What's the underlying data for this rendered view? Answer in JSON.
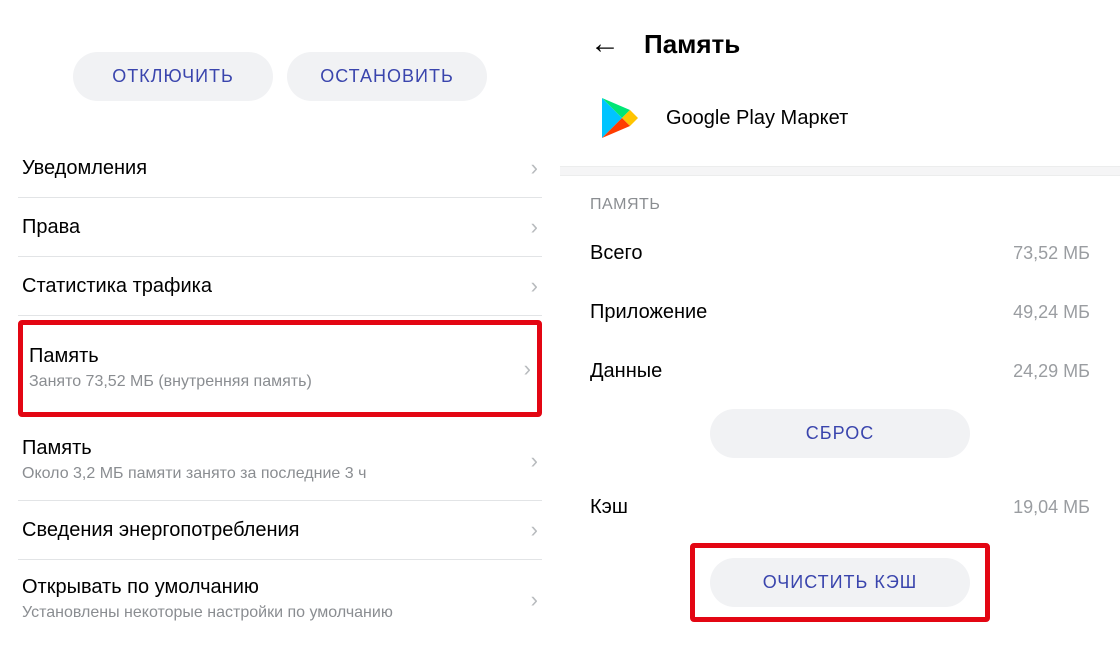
{
  "left": {
    "buttons": {
      "disable": "ОТКЛЮЧИТЬ",
      "stop": "ОСТАНОВИТЬ"
    },
    "items": {
      "notifications": "Уведомления",
      "permissions": "Права",
      "traffic": "Статистика трафика",
      "storage_title": "Память",
      "storage_sub": "Занято 73,52 МБ (внутренняя память)",
      "memory_title": "Память",
      "memory_sub": "Около 3,2 МБ памяти занято за последние 3 ч",
      "energy": "Сведения энергопотребления",
      "default_title": "Открывать по умолчанию",
      "default_sub": "Установлены некоторые настройки по умолчанию"
    }
  },
  "right": {
    "header": "Память",
    "app_name": "Google Play Маркет",
    "section": "ПАМЯТЬ",
    "rows": {
      "total_k": "Всего",
      "total_v": "73,52 МБ",
      "app_k": "Приложение",
      "app_v": "49,24 МБ",
      "data_k": "Данные",
      "data_v": "24,29 МБ",
      "cache_k": "Кэш",
      "cache_v": "19,04 МБ"
    },
    "buttons": {
      "reset": "СБРОС",
      "clear_cache": "ОЧИСТИТЬ КЭШ"
    }
  }
}
